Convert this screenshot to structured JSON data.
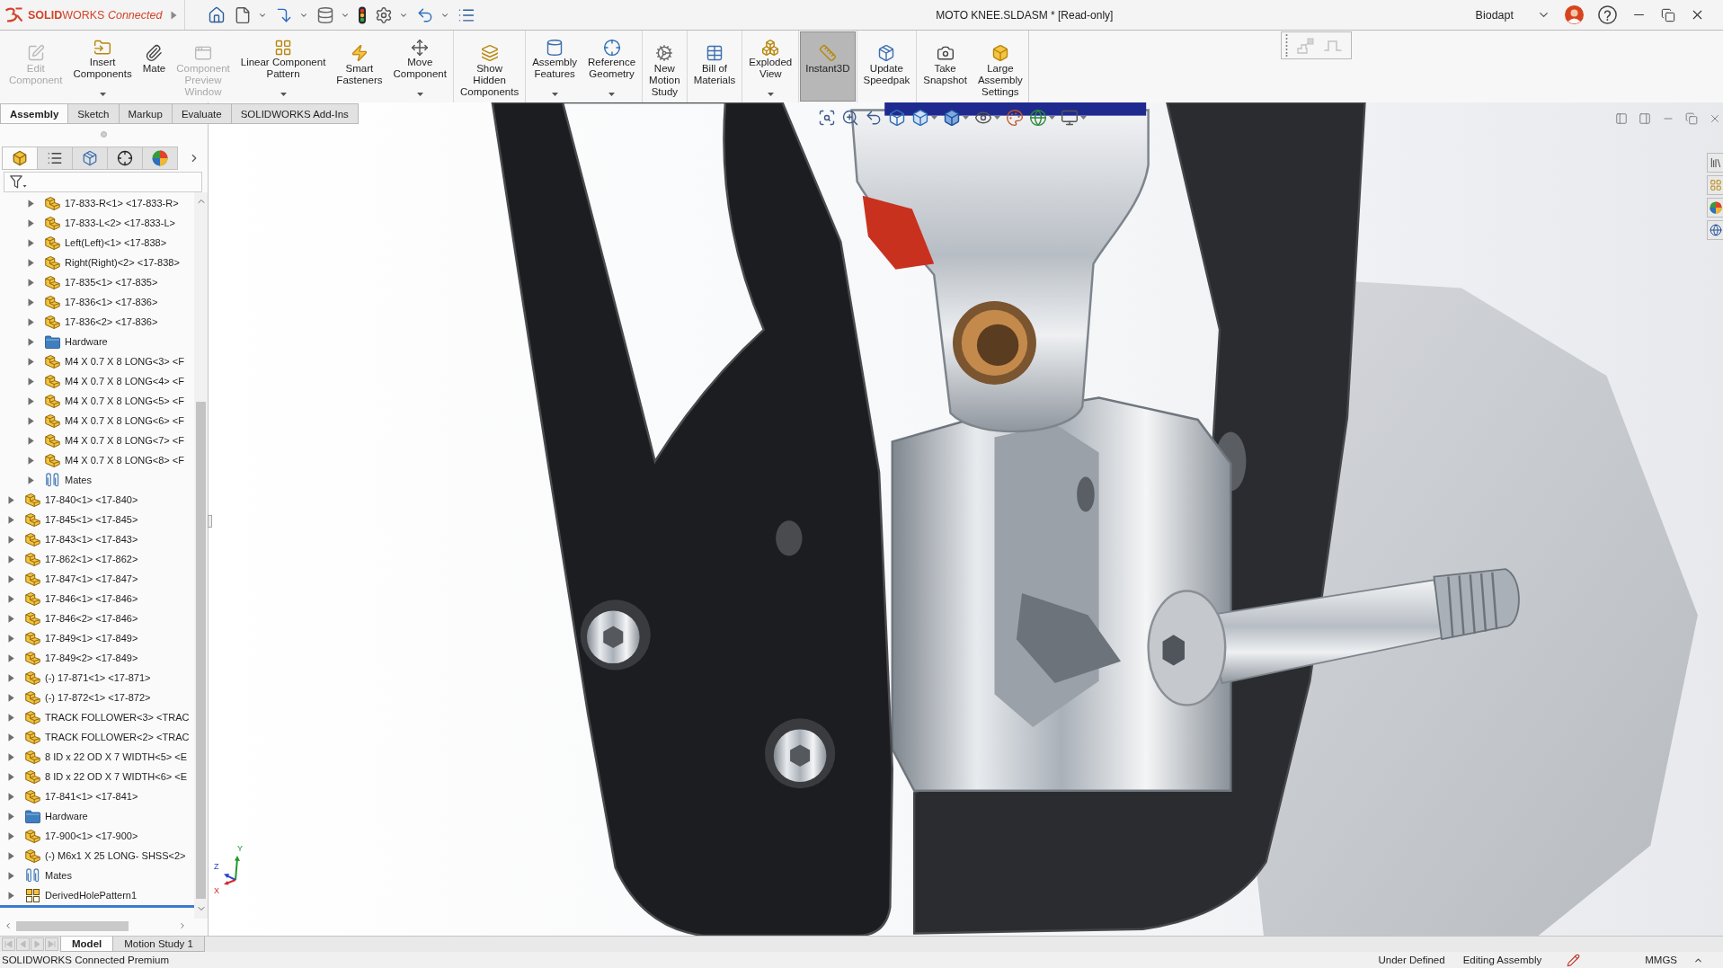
{
  "title_bar": {
    "app_name": "**SOLID**WORKS *Connected*",
    "document_title": "MOTO KNEE.SLDASM * [Read-only]",
    "user_name": "Biodapt"
  },
  "quick_access": [
    {
      "dropdown": false
    },
    {
      "dropdown": true
    },
    {
      "dropdown": true
    },
    {
      "dropdown": true
    },
    {
      "dropdown": false
    },
    {
      "dropdown": true
    },
    {
      "dropdown": true
    },
    {
      "dropdown": false
    }
  ],
  "ribbon": {
    "groups": [
      [
        {
          "label": "Edit\nComponent",
          "dropdown": false,
          "disabled": true,
          "pressed": false
        },
        {
          "label": "Insert\nComponents",
          "dropdown": true,
          "disabled": false,
          "pressed": false
        },
        {
          "label": "Mate",
          "dropdown": false,
          "disabled": false,
          "pressed": false
        },
        {
          "label": "Component\nPreview\nWindow",
          "dropdown": false,
          "disabled": true,
          "pressed": false
        },
        {
          "label": "Linear Component\nPattern",
          "dropdown": true,
          "disabled": false,
          "pressed": false
        },
        {
          "label": "Smart\nFasteners",
          "dropdown": false,
          "disabled": false,
          "pressed": false
        },
        {
          "label": "Move\nComponent",
          "dropdown": true,
          "disabled": false,
          "pressed": false
        }
      ],
      [
        {
          "label": "Show\nHidden\nComponents",
          "dropdown": false,
          "disabled": false,
          "pressed": false
        }
      ],
      [
        {
          "label": "Assembly\nFeatures",
          "dropdown": true,
          "disabled": false,
          "pressed": false
        },
        {
          "label": "Reference\nGeometry",
          "dropdown": true,
          "disabled": false,
          "pressed": false
        }
      ],
      [
        {
          "label": "New\nMotion\nStudy",
          "dropdown": false,
          "disabled": false,
          "pressed": false
        }
      ],
      [
        {
          "label": "Bill of\nMaterials",
          "dropdown": false,
          "disabled": false,
          "pressed": false
        }
      ],
      [
        {
          "label": "Exploded\nView",
          "dropdown": true,
          "disabled": false,
          "pressed": false
        }
      ],
      [
        {
          "label": "Instant3D",
          "dropdown": false,
          "disabled": false,
          "pressed": true
        }
      ],
      [
        {
          "label": "Update\nSpeedpak",
          "dropdown": false,
          "disabled": false,
          "pressed": false
        }
      ],
      [
        {
          "label": "Take\nSnapshot",
          "dropdown": false,
          "disabled": false,
          "pressed": false
        },
        {
          "label": "Large\nAssembly\nSettings",
          "dropdown": false,
          "disabled": false,
          "pressed": false
        }
      ]
    ]
  },
  "command_tabs": [
    {
      "label": "Assembly",
      "selected": true
    },
    {
      "label": "Sketch",
      "selected": false
    },
    {
      "label": "Markup",
      "selected": false
    },
    {
      "label": "Evaluate",
      "selected": false
    },
    {
      "label": "SOLIDWORKS Add-Ins",
      "selected": false
    }
  ],
  "feature_manager": {
    "panel_tabs": [
      {
        "selected": true
      },
      {
        "selected": false
      },
      {
        "selected": false
      },
      {
        "selected": false
      },
      {
        "selected": false
      }
    ],
    "tree": [
      {
        "children": [
          {
            "label": "17-833-R<1> <17-833-R>",
            "kind": "part",
            "expanded": false
          },
          {
            "label": "17-833-L<2> <17-833-L>",
            "kind": "part",
            "expanded": false
          },
          {
            "label": "Left(Left)<1> <17-838>",
            "kind": "part",
            "expanded": false
          },
          {
            "label": "Right(Right)<2> <17-838>",
            "kind": "part",
            "expanded": false
          },
          {
            "label": "17-835<1> <17-835>",
            "kind": "part",
            "expanded": false
          },
          {
            "label": "17-836<1> <17-836>",
            "kind": "part",
            "expanded": false
          },
          {
            "label": "17-836<2> <17-836>",
            "kind": "part",
            "expanded": false
          },
          {
            "label": "Hardware",
            "kind": "folder",
            "expanded": false
          },
          {
            "label": "M4 X 0.7 X 8 LONG<3> <F",
            "kind": "part",
            "expanded": false
          },
          {
            "label": "M4 X 0.7 X 8 LONG<4> <F",
            "kind": "part",
            "expanded": false
          },
          {
            "label": "M4 X 0.7 X 8 LONG<5> <F",
            "kind": "part",
            "expanded": false
          },
          {
            "label": "M4 X 0.7 X 8 LONG<6> <F",
            "kind": "part",
            "expanded": false
          },
          {
            "label": "M4 X 0.7 X 8 LONG<7> <F",
            "kind": "part",
            "expanded": false
          },
          {
            "label": "M4 X 0.7 X 8 LONG<8> <F",
            "kind": "part",
            "expanded": false
          },
          {
            "label": "Mates",
            "kind": "mates",
            "expanded": false
          }
        ]
      },
      {
        "label": "17-840<1> <17-840>",
        "kind": "part",
        "expanded": false
      },
      {
        "label": "17-845<1> <17-845>",
        "kind": "part",
        "expanded": false
      },
      {
        "label": "17-843<1> <17-843>",
        "kind": "part",
        "expanded": false
      },
      {
        "label": "17-862<1> <17-862>",
        "kind": "part",
        "expanded": false
      },
      {
        "label": "17-847<1> <17-847>",
        "kind": "part",
        "expanded": false
      },
      {
        "label": "17-846<1> <17-846>",
        "kind": "part",
        "expanded": false
      },
      {
        "label": "17-846<2> <17-846>",
        "kind": "part",
        "expanded": false
      },
      {
        "label": "17-849<1> <17-849>",
        "kind": "part",
        "expanded": false
      },
      {
        "label": "17-849<2> <17-849>",
        "kind": "part",
        "expanded": false
      },
      {
        "label": "(-) 17-871<1> <17-871>",
        "kind": "part",
        "expanded": false
      },
      {
        "label": "(-) 17-872<1> <17-872>",
        "kind": "part",
        "expanded": false
      },
      {
        "label": "TRACK FOLLOWER<3> <TRAC",
        "kind": "part",
        "expanded": false
      },
      {
        "label": "TRACK FOLLOWER<2> <TRAC",
        "kind": "part",
        "expanded": false
      },
      {
        "label": "8 ID x 22 OD X 7 WIDTH<5> <E",
        "kind": "part",
        "expanded": false
      },
      {
        "label": "8 ID x 22 OD X 7 WIDTH<6> <E",
        "kind": "part",
        "expanded": false
      },
      {
        "label": "17-841<1> <17-841>",
        "kind": "part",
        "expanded": false
      },
      {
        "label": "Hardware",
        "kind": "folder",
        "expanded": false
      },
      {
        "label": "17-900<1> <17-900>",
        "kind": "part",
        "expanded": false
      },
      {
        "label": "(-) M6x1 X 25 LONG- SHSS<2>",
        "kind": "part",
        "expanded": false
      },
      {
        "label": "Mates",
        "kind": "mates",
        "expanded": false
      },
      {
        "label": "DerivedHolePattern1",
        "kind": "pattern",
        "expanded": false
      }
    ]
  },
  "view_toolbar": [
    {
      "dropdown": false
    },
    {
      "dropdown": false
    },
    {
      "dropdown": false
    },
    {
      "dropdown": false
    },
    {
      "dropdown": true
    },
    {
      "dropdown": true
    },
    {
      "dropdown": true
    },
    {
      "dropdown": false
    },
    {
      "dropdown": true
    },
    {
      "dropdown": true
    }
  ],
  "triad": {
    "axes": [
      {
        "label": "Y"
      },
      {
        "label": "Z"
      },
      {
        "label": "X"
      }
    ]
  },
  "bottom_tabs": [
    {
      "label": "Model",
      "selected": true
    },
    {
      "label": "Motion Study 1",
      "selected": false
    }
  ],
  "status_bar": {
    "product": "SOLIDWORKS Connected Premium",
    "sketch_state": "Under Defined",
    "mode": "Editing Assembly",
    "units": "MMGS"
  }
}
